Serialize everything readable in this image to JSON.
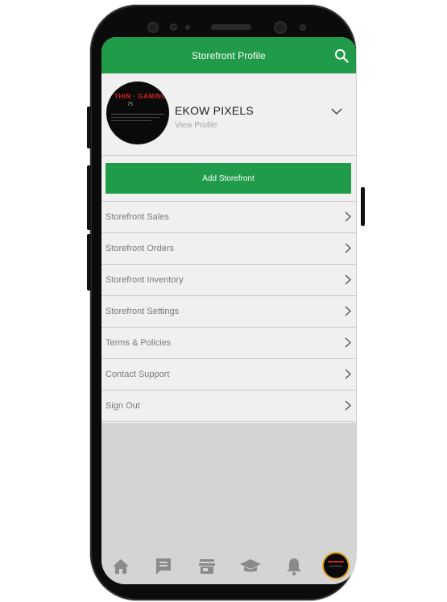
{
  "header": {
    "title": "Storefront Profile",
    "search_icon": "search-icon"
  },
  "profile": {
    "name": "EKOW PIXELS",
    "view_profile_label": "View Profile",
    "avatar_text": "THIN · GAMING",
    "avatar_subtext": "75",
    "expand_icon": "chevron-down-icon"
  },
  "actions": {
    "add_storefront_label": "Add Storefront"
  },
  "menu": {
    "items": [
      {
        "label": "Storefront Sales"
      },
      {
        "label": "Storefront Orders"
      },
      {
        "label": "Storefront Inventory"
      },
      {
        "label": "Storefront Settings"
      },
      {
        "label": "Terms & Policies"
      },
      {
        "label": "Contact Support"
      },
      {
        "label": "Sign Out"
      }
    ]
  },
  "tabbar": {
    "items": [
      {
        "name": "home",
        "icon": "home-icon"
      },
      {
        "name": "messages",
        "icon": "chat-icon"
      },
      {
        "name": "storefront",
        "icon": "store-icon"
      },
      {
        "name": "learn",
        "icon": "graduation-cap-icon"
      },
      {
        "name": "notifications",
        "icon": "bell-icon"
      },
      {
        "name": "profile",
        "icon": "avatar"
      }
    ]
  },
  "colors": {
    "accent": "#1f9b4a",
    "background": "#d4d4d4",
    "sheet": "#f0f0f0",
    "text_muted": "#7a7a7a"
  }
}
